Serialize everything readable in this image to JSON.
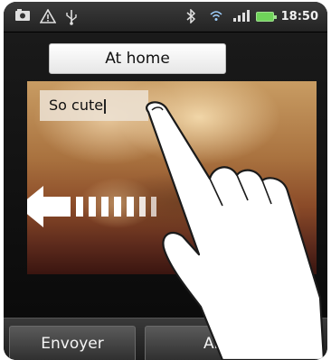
{
  "status_bar": {
    "time": "18:50",
    "icons": [
      "photo-icon",
      "warning-icon",
      "usb-icon",
      "bluetooth-icon",
      "wifi-icon",
      "signal-icon",
      "battery-icon"
    ]
  },
  "compose": {
    "title": "At home",
    "caption": "So cute"
  },
  "buttons": {
    "send_label": "Envoyer",
    "cancel_label": "Annuler"
  }
}
